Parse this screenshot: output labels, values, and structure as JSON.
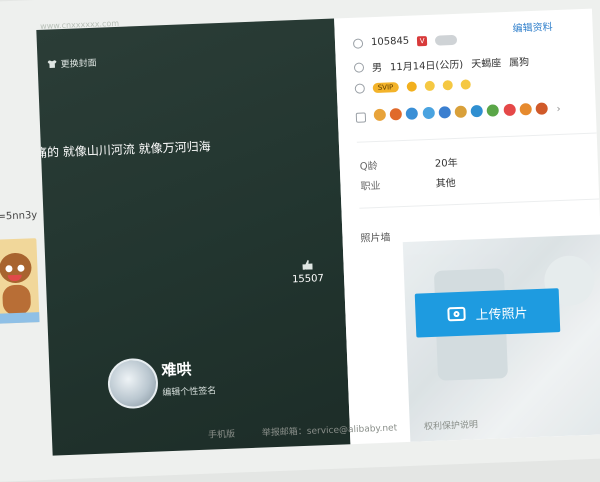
{
  "background": {
    "url_hint": "www.cnxxxxxx.com",
    "user_id_fragment": "r=5nn3y"
  },
  "left_panel": {
    "change_cover": "更换封面",
    "banner_text": "痛的 就像山川河流 就像万河归海",
    "like_count": "15507",
    "nickname": "难哄",
    "signature_prompt": "编辑个性签名"
  },
  "right_panel": {
    "edit_profile": "编辑资料",
    "qq_number": "105845",
    "gender": "男",
    "birthday": "11月14日(公历)",
    "zodiac": "天蝎座",
    "chinese_zodiac": "属狗",
    "vip_badge": "SVIP",
    "q_age_label": "Q龄",
    "q_age_value": "20年",
    "job_label": "职业",
    "job_value": "其他",
    "photo_wall": "照片墙",
    "upload_photo": "上传照片"
  },
  "footer": {
    "mobile": "手机版",
    "report_email": "举报邮箱：service@alibaby.net",
    "copyright": "权利保护说明"
  },
  "colors": {
    "left_panel_bg": "#22352f",
    "accent_blue": "#1e9be0",
    "link_blue": "#2f7fcb"
  }
}
